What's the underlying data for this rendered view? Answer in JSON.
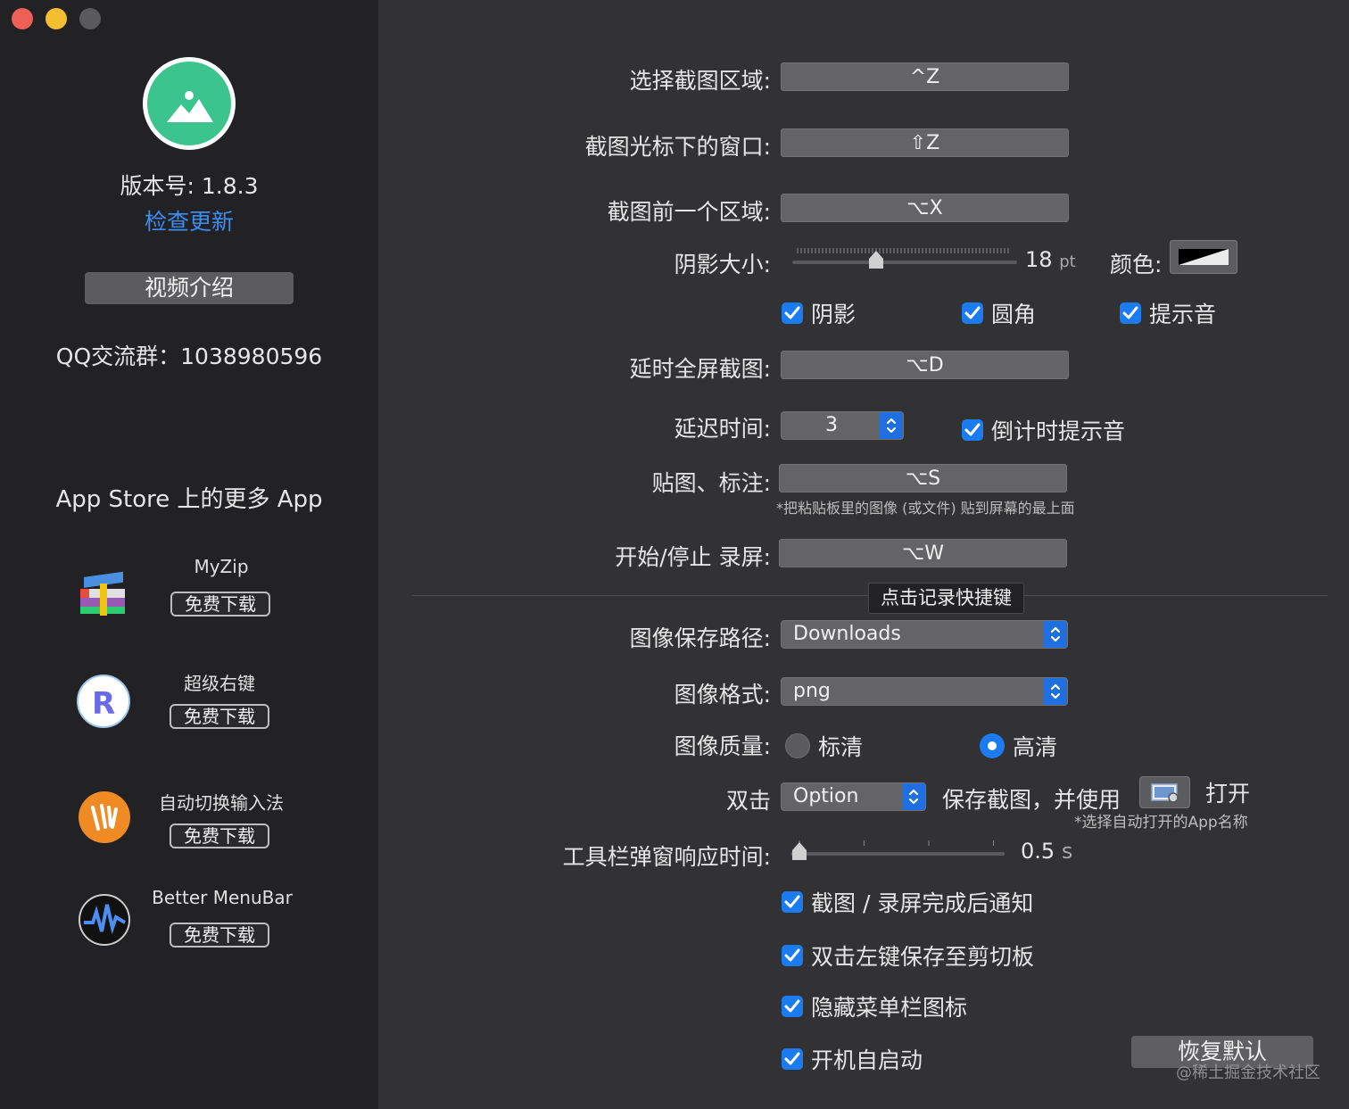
{
  "sidebar": {
    "version": "版本号: 1.8.3",
    "check_update": "检查更新",
    "video_intro": "视频介绍",
    "qq_group": "QQ交流群：1038980596",
    "more_apps_title": "App Store 上的更多 App",
    "apps": [
      {
        "name": "MyZip",
        "button": "免费下载",
        "icon": "myzip-icon"
      },
      {
        "name": "超级右键",
        "button": "免费下载",
        "icon": "super-right-click-icon"
      },
      {
        "name": "自动切换输入法",
        "button": "免费下载",
        "icon": "auto-input-switch-icon"
      },
      {
        "name": "Better MenuBar",
        "button": "免费下载",
        "icon": "better-menubar-icon"
      }
    ]
  },
  "shortcuts": {
    "select_area_label": "选择截图区域:",
    "select_area_value": "^Z",
    "window_label": "截图光标下的窗口:",
    "window_value": "⇧Z",
    "prev_area_label": "截图前一个区域:",
    "prev_area_value": "⌥X",
    "fullscreen_label": "延时全屏截图:",
    "fullscreen_value": "⌥D",
    "pin_label": "贴图、标注:",
    "pin_value": "⌥S",
    "pin_hint": "*把粘贴板里的图像 (或文件) 贴到屏幕的最上面",
    "record_label": "开始/停止 录屏:",
    "record_value": "⌥W",
    "record_hotkey_tab": "点击记录快捷键"
  },
  "shadow": {
    "label": "阴影大小:",
    "value": "18",
    "unit": "pt",
    "level_fraction": 0.36,
    "color_label": "颜色:"
  },
  "toggles": {
    "shadow": "阴影",
    "rounded": "圆角",
    "sound": "提示音",
    "countdown_sound": "倒计时提示音"
  },
  "delay": {
    "label": "延迟时间:",
    "value": "3"
  },
  "save": {
    "path_label": "图像保存路径:",
    "path_value": "Downloads",
    "format_label": "图像格式:",
    "format_value": "png",
    "quality_label": "图像质量:",
    "quality_sd": "标清",
    "quality_hd": "高清",
    "quality_selected": "高清"
  },
  "double_click": {
    "label": "双击",
    "modifier": "Option",
    "text": "保存截图，并使用",
    "open": "打开",
    "hint": "*选择自动打开的App名称",
    "app_icon": "preview-app-icon"
  },
  "toolbar_delay": {
    "label": "工具栏弹窗响应时间:",
    "value": "0.5",
    "unit": "s",
    "level_fraction": 0.0
  },
  "options": {
    "notify": "截图 / 录屏完成后通知",
    "dblclick_clipboard": "双击左键保存至剪切板",
    "hide_menubar_icon": "隐藏菜单栏图标",
    "launch_at_login": "开机自启动"
  },
  "reset_button": "恢复默认",
  "watermark": "@稀土掘金技术社区",
  "colors": {
    "accent": "#1a7cf0",
    "link": "#3b8ef5",
    "sidebar_bg": "#222224",
    "main_bg": "#323234",
    "logo_green": "#3cc48e"
  }
}
